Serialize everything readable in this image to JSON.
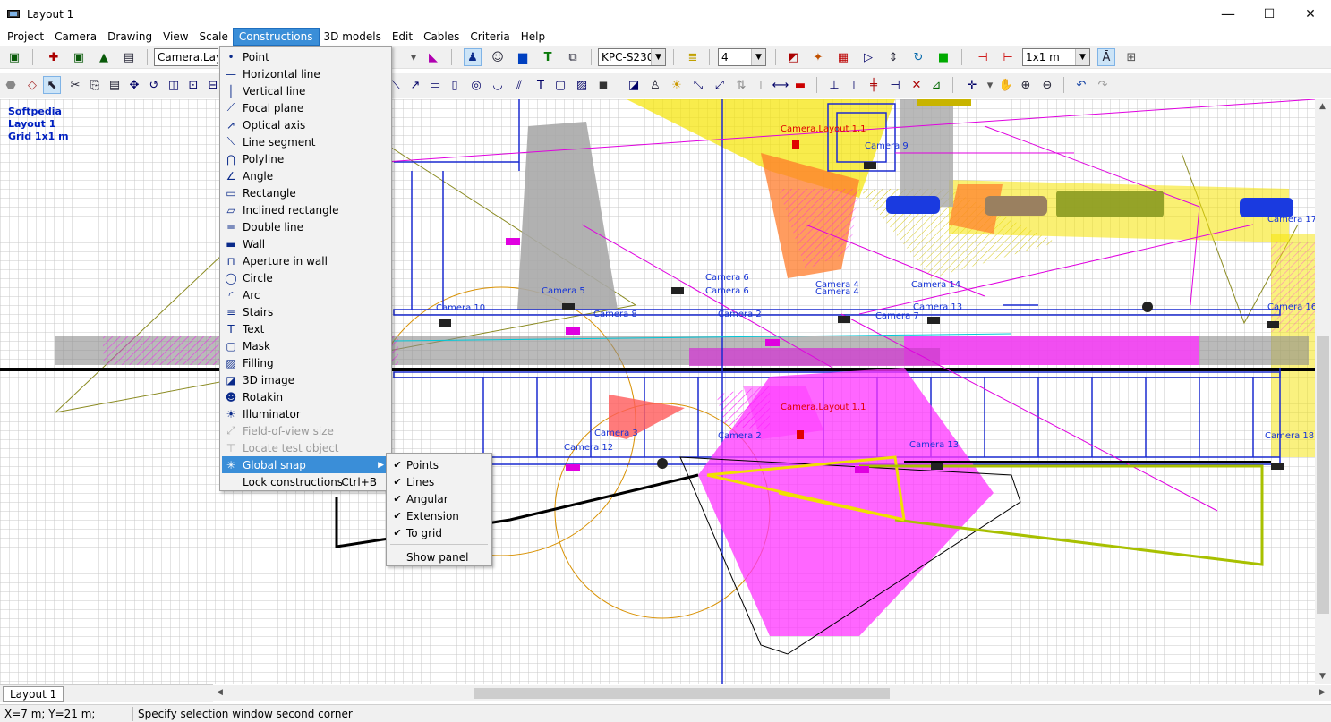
{
  "window": {
    "title": "Layout 1",
    "min": "—",
    "max": "☐",
    "close": "✕"
  },
  "menubar": [
    "Project",
    "Camera",
    "Drawing",
    "View",
    "Scale",
    "Constructions",
    "3D models",
    "Edit",
    "Cables",
    "Criteria",
    "Help"
  ],
  "toolbar1": {
    "camera_combo": "Camera.Layo",
    "model_combo": "KPC-S230C",
    "count_combo": "4",
    "scale_combo": "1x1 m"
  },
  "canvas_info": {
    "line1": "Softpedia",
    "line2": "Layout 1",
    "line3": "Grid 1x1 m"
  },
  "camera_labels": {
    "c1_top": "Camera.Layout 1.1",
    "c1_mid": "Camera.Layout 1.1",
    "c2": "Camera 2",
    "c3": "Camera 3",
    "c4a": "Camera 4",
    "c4b": "Camera 4",
    "c5": "Camera 5",
    "c6a": "Camera 6",
    "c6b": "Camera 6",
    "c7": "Camera 7",
    "c9": "Camera 9",
    "c10": "Camera 10",
    "c12": "Camera 12",
    "c13a": "Camera 13",
    "c13b": "Camera 13",
    "c14": "Camera 14",
    "c16": "Camera 16",
    "c17": "Camera 17",
    "c18": "Camera 18",
    "c8": "Camera 8",
    "c2b": "Camera 2"
  },
  "constructions_menu": [
    {
      "label": "Point",
      "icon": "point-icon",
      "glyph": "•"
    },
    {
      "label": "Horizontal line",
      "icon": "horizontal-line-icon",
      "glyph": "—"
    },
    {
      "label": "Vertical line",
      "icon": "vertical-line-icon",
      "glyph": "│"
    },
    {
      "label": "Focal plane",
      "icon": "focal-plane-icon",
      "glyph": "⟋"
    },
    {
      "label": "Optical axis",
      "icon": "optical-axis-icon",
      "glyph": "↗"
    },
    {
      "label": "Line segment",
      "icon": "line-segment-icon",
      "glyph": "⟍"
    },
    {
      "label": "Polyline",
      "icon": "polyline-icon",
      "glyph": "⋂"
    },
    {
      "label": "Angle",
      "icon": "angle-icon",
      "glyph": "∠"
    },
    {
      "label": "Rectangle",
      "icon": "rectangle-icon",
      "glyph": "▭"
    },
    {
      "label": "Inclined rectangle",
      "icon": "inclined-rectangle-icon",
      "glyph": "▱"
    },
    {
      "label": "Double line",
      "icon": "double-line-icon",
      "glyph": "═"
    },
    {
      "label": "Wall",
      "icon": "wall-icon",
      "glyph": "▬"
    },
    {
      "label": "Aperture in wall",
      "icon": "aperture-icon",
      "glyph": "⊓"
    },
    {
      "label": "Circle",
      "icon": "circle-icon",
      "glyph": "◯"
    },
    {
      "label": "Arc",
      "icon": "arc-icon",
      "glyph": "◜"
    },
    {
      "label": "Stairs",
      "icon": "stairs-icon",
      "glyph": "≡"
    },
    {
      "label": "Text",
      "icon": "text-icon",
      "glyph": "T"
    },
    {
      "label": "Mask",
      "icon": "mask-icon",
      "glyph": "▢"
    },
    {
      "label": "Filling",
      "icon": "filling-icon",
      "glyph": "▨"
    },
    {
      "label": "3D image",
      "icon": "3d-image-icon",
      "glyph": "◪"
    },
    {
      "label": "Rotakin",
      "icon": "rotakin-icon",
      "glyph": "☻"
    },
    {
      "label": "Illuminator",
      "icon": "illuminator-icon",
      "glyph": "☀"
    },
    {
      "label": "Field-of-view size",
      "icon": "fov-size-icon",
      "glyph": "⤢",
      "disabled": true
    },
    {
      "label": "Locate test object",
      "icon": "locate-icon",
      "glyph": "⊤",
      "disabled": true
    },
    {
      "label": "Global snap",
      "icon": "global-snap-icon",
      "glyph": "✳",
      "highlight": true,
      "submenu": true
    },
    {
      "label": "Lock constructions",
      "icon": "",
      "glyph": "",
      "shortcut": "Ctrl+B"
    }
  ],
  "snap_submenu": [
    {
      "label": "Points",
      "checked": true
    },
    {
      "label": "Lines",
      "checked": true
    },
    {
      "label": "Angular",
      "checked": true
    },
    {
      "label": "Extension",
      "checked": true
    },
    {
      "label": "To grid",
      "checked": true
    }
  ],
  "snap_panel_label": "Show panel",
  "tabs": [
    "Layout 1"
  ],
  "status": {
    "coords": "X=7 m; Y=21 m;",
    "message": "Specify selection window second corner"
  },
  "colors": {
    "menu_highlight": "#3a8ed8",
    "camera_label": "#1533d6",
    "camera_label_selected": "#e00000",
    "fov_magenta": "#ff33ff",
    "fov_yellow": "#f5e400",
    "fov_orange": "#ff7b2a"
  }
}
